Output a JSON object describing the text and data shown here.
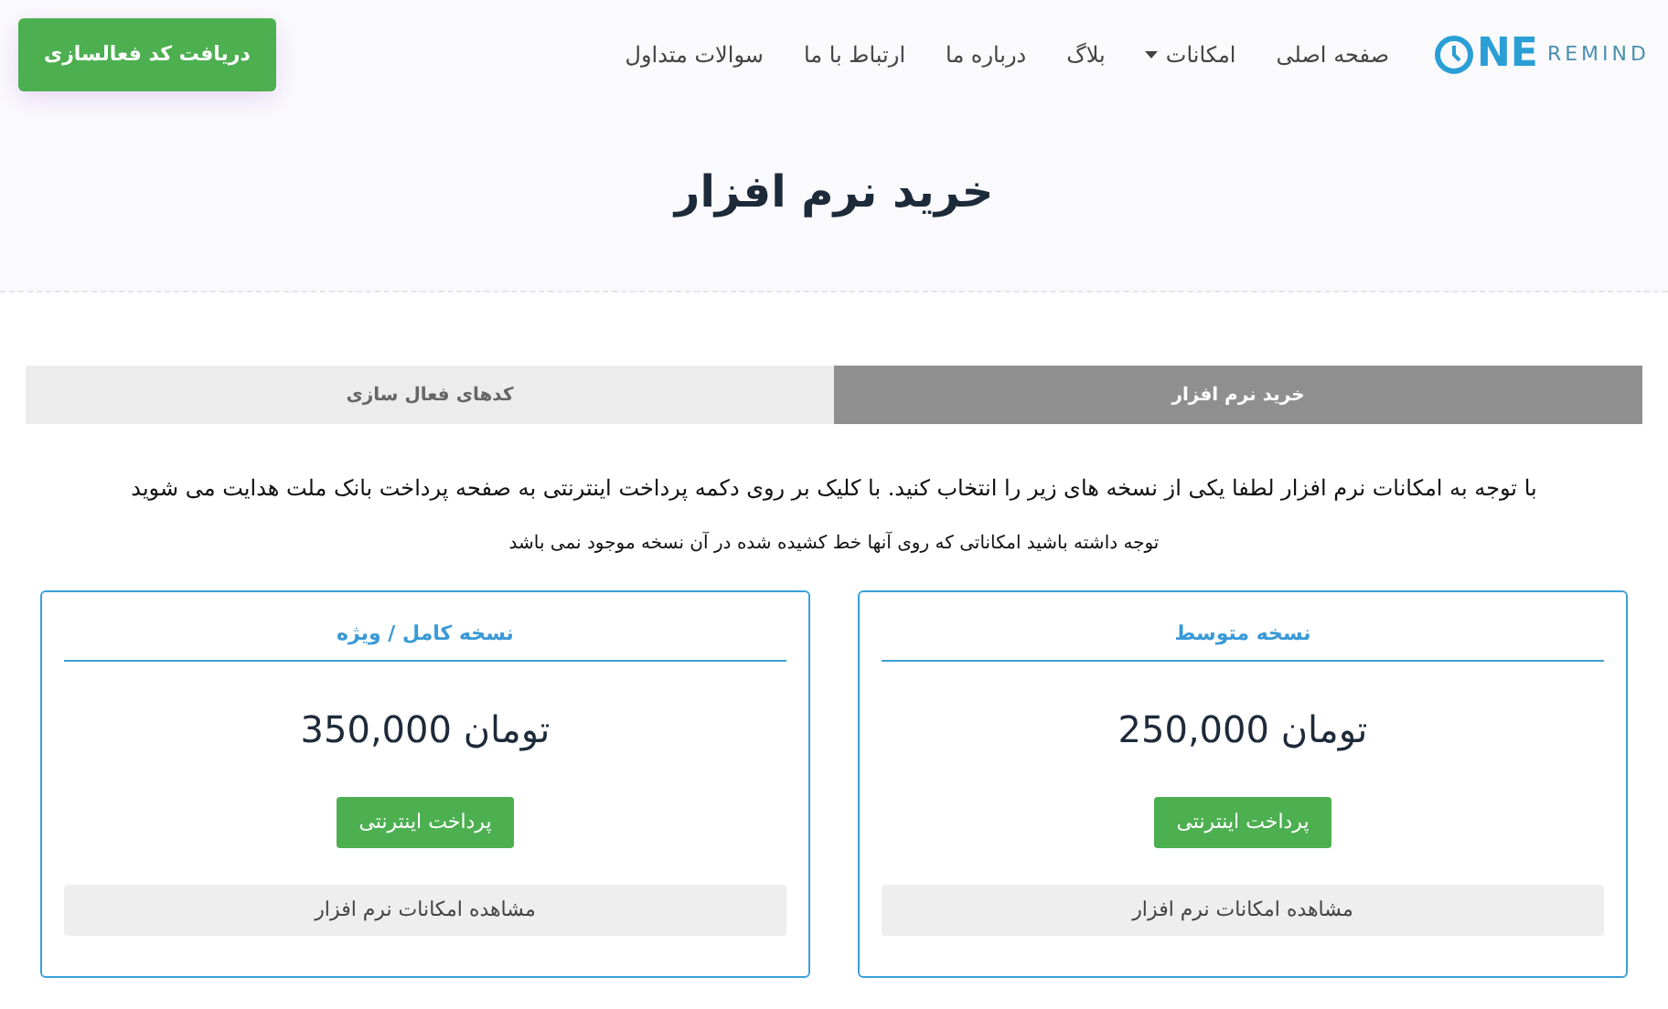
{
  "header": {
    "logo": {
      "mark": "NE",
      "word": "REMIND"
    },
    "nav": [
      {
        "label": "صفحه اصلی",
        "dropdown": false
      },
      {
        "label": "امکانات",
        "dropdown": true
      },
      {
        "label": "بلاگ",
        "dropdown": false
      },
      {
        "label": "درباره ما",
        "dropdown": false
      },
      {
        "label": "ارتباط با ما",
        "dropdown": false
      },
      {
        "label": "سوالات متداول",
        "dropdown": false
      }
    ],
    "cta": "دریافت کد فعالسازی"
  },
  "title": "خرید نرم افزار",
  "tabs": [
    {
      "label": "خرید نرم افزار",
      "selected": true
    },
    {
      "label": "کدهای فعال سازی",
      "selected": false
    }
  ],
  "intro": "با توجه به امکانات نرم افزار لطفا یکی از نسخه های زیر را انتخاب کنید. با کلیک بر روی دکمه پرداخت اینترنتی به صفحه پرداخت بانک ملت هدایت می شوید",
  "note": "توجه داشته باشید امکاناتی که روی آنها خط کشیده شده در آن نسخه موجود نمی باشد",
  "plans": [
    {
      "name": "نسخه متوسط",
      "price": "250,000 تومان",
      "pay": "پرداخت اینترنتی",
      "features": "مشاهده امکانات نرم افزار"
    },
    {
      "name": "نسخه کامل / ویژه",
      "price": "350,000 تومان",
      "pay": "پرداخت اینترنتی",
      "features": "مشاهده امکانات نرم افزار"
    }
  ]
}
